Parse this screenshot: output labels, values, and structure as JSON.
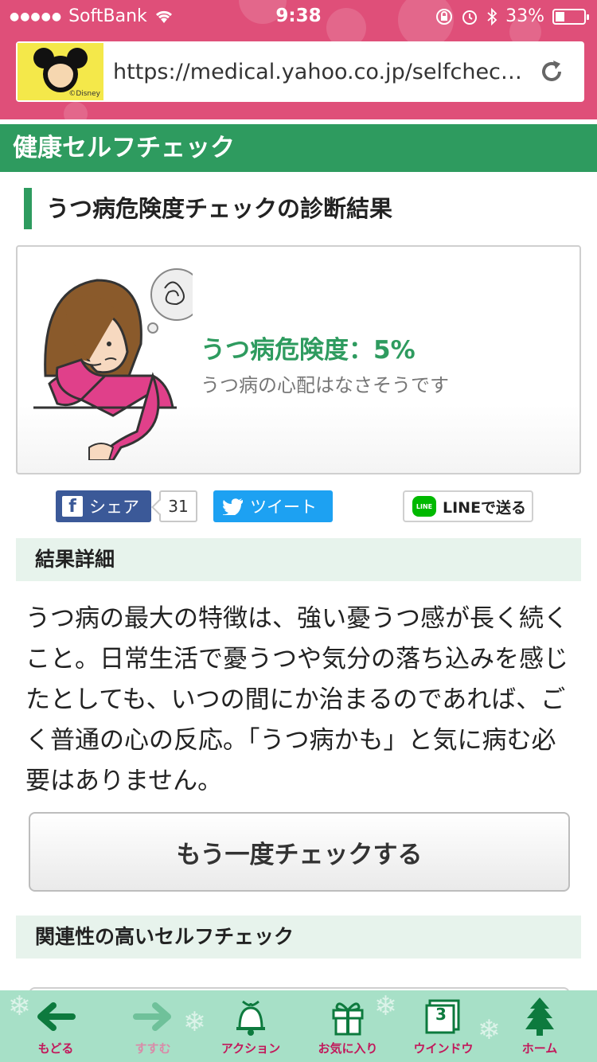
{
  "status_bar": {
    "signal": "●●●●●",
    "carrier": "SoftBank",
    "time": "9:38",
    "battery_text": "33%",
    "battery_level": 0.33
  },
  "browser": {
    "url": "https://medical.yahoo.co.jp/selfchec…",
    "favicon_text": "©Disney"
  },
  "site": {
    "header_title": "健康セルフチェック"
  },
  "result": {
    "section_title": "うつ病危険度チェックの診断結果",
    "risk_label": "うつ病危険度：5%",
    "message": "うつ病の心配はなさそうです"
  },
  "share": {
    "facebook_label": "シェア",
    "facebook_count": "31",
    "twitter_label": "ツイート",
    "line_logo": "LINE",
    "line_label": "LINEで送る"
  },
  "details": {
    "heading": "結果詳細",
    "body": "うつ病の最大の特徴は、強い憂うつ感が長く続くこと。日常生活で憂うつや気分の落ち込みを感じたとしても、いつの間にか治まるのであれば、ごく普通の心の反応。「うつ病かも」と気に病む必要はありません。"
  },
  "recheck_button": "もう一度チェックする",
  "related_heading": "関連性の高いセルフチェック",
  "toolbar": {
    "back": "もどる",
    "forward": "すすむ",
    "action": "アクション",
    "favorites": "お気に入り",
    "window": "ウインドウ",
    "window_count": "3",
    "home": "ホーム"
  },
  "colors": {
    "brand_green": "#2e9b5f",
    "toolbar_pink": "#c2185b",
    "status_pink": "#df4f79"
  }
}
